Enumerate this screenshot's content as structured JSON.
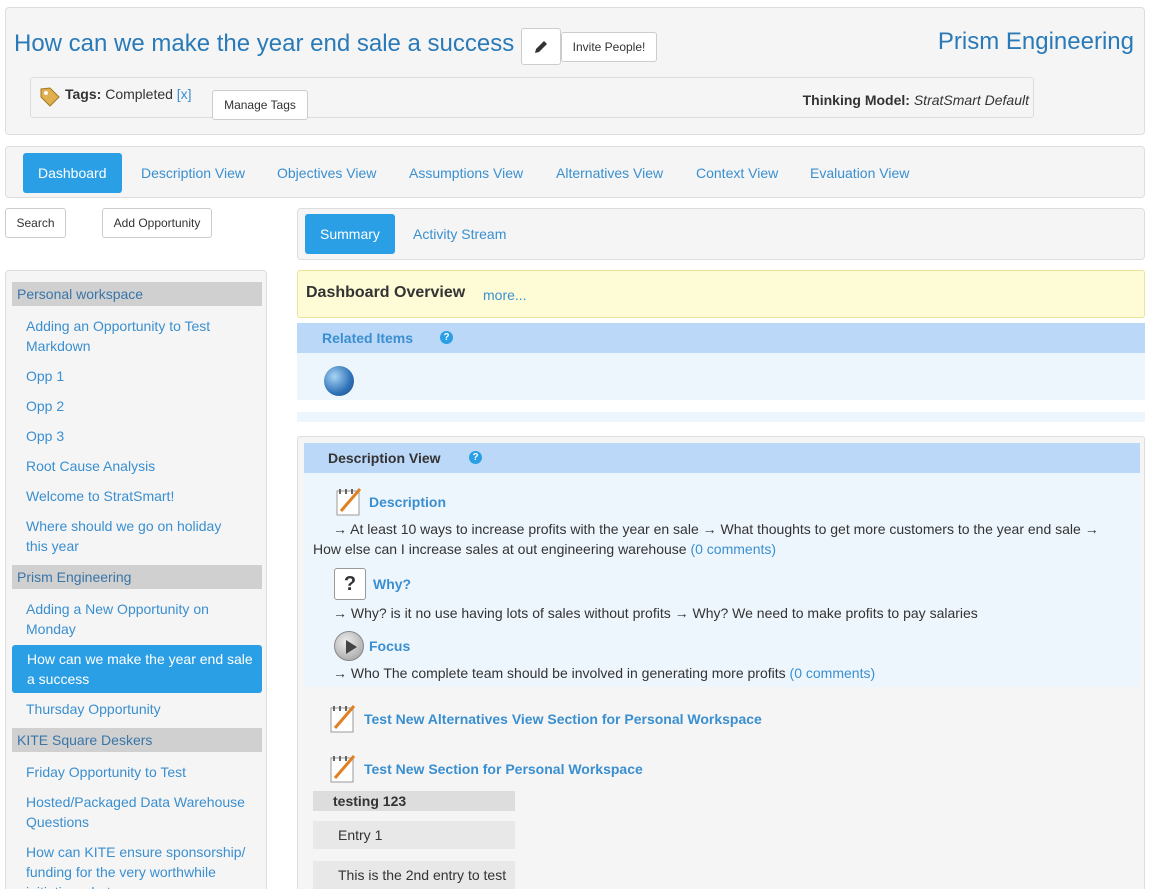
{
  "header": {
    "title": "How can we make the year end sale a success",
    "invite_label": "Invite People!",
    "company": "Prism Engineering",
    "tags_label": "Tags:",
    "tags_value": "Completed",
    "tags_remove": "[x]",
    "manage_tags_label": "Manage Tags",
    "thinking_label": "Thinking Model:",
    "thinking_value": "StratSmart Default"
  },
  "main_tabs": [
    {
      "label": "Dashboard",
      "active": true
    },
    {
      "label": "Description View"
    },
    {
      "label": "Objectives View"
    },
    {
      "label": "Assumptions View"
    },
    {
      "label": "Alternatives View"
    },
    {
      "label": "Context View"
    },
    {
      "label": "Evaluation View"
    }
  ],
  "toolbar": {
    "search_label": "Search",
    "add_label": "Add Opportunity"
  },
  "sidebar": {
    "groups": [
      {
        "name": "Personal workspace",
        "items": [
          "Adding an Opportunity to Test Markdown",
          "Opp 1",
          "Opp 2",
          "Opp 3",
          "Root Cause Analysis",
          "Welcome to StratSmart!",
          "Where should we go on holiday this year"
        ]
      },
      {
        "name": "Prism Engineering",
        "items": [
          "Adding a New Opportunity on Monday",
          "How can we make the year end sale a success",
          "Thursday Opportunity"
        ]
      },
      {
        "name": "KITE Square Deskers",
        "items": [
          "Friday Opportunity to Test",
          "Hosted/Packaged Data Warehouse Questions",
          "How can KITE ensure sponsorship/ funding for the very worthwhile initiatives, but"
        ]
      }
    ],
    "active_item": "How can we make the year end sale a success"
  },
  "sub_tabs": [
    {
      "label": "Summary",
      "active": true
    },
    {
      "label": "Activity Stream"
    }
  ],
  "overview": {
    "title": "Dashboard Overview",
    "more": "more..."
  },
  "related": {
    "title": "Related Items",
    "help": "?"
  },
  "description_view": {
    "title": "Description View",
    "help": "?",
    "sections": {
      "description": {
        "title": "Description",
        "text_line1": "→ At least 10 ways to increase profits with the year en sale → What thoughts to get more customers to the year end sale →",
        "text_line2": "How else can I increase sales at out engineering warehouse",
        "comments": "(0 comments)"
      },
      "why": {
        "title": "Why?",
        "icon_glyph": "?",
        "text": "→ Why? is it no use having lots of sales without profits → Why? We need to make profits to pay salaries"
      },
      "focus": {
        "title": "Focus",
        "text": "→ Who The complete team should be involved in generating more profits",
        "comments": "(0 comments)"
      }
    },
    "extra_sections": [
      "Test New Alternatives View Section for Personal Workspace",
      "Test New Section for Personal Workspace"
    ],
    "testing": {
      "title": "testing 123",
      "entries": [
        "Entry 1",
        "This is the 2nd entry to test"
      ]
    }
  }
}
